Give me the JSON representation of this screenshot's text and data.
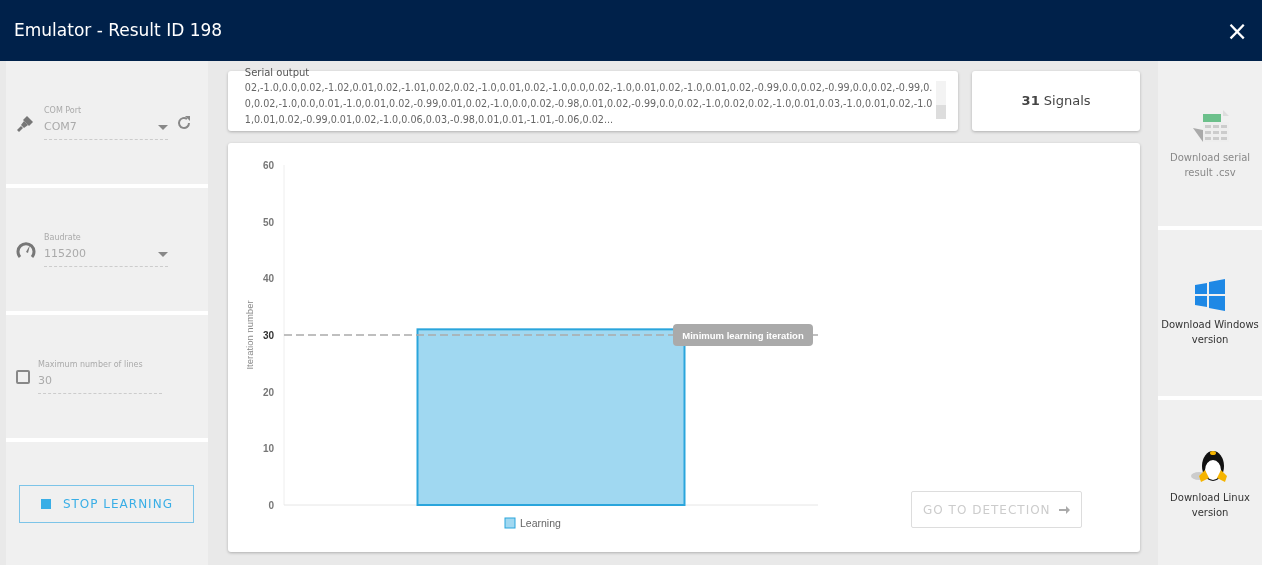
{
  "window": {
    "title": "Emulator - Result ID 198",
    "close": "×"
  },
  "settings": [
    {
      "kind": "select",
      "label": "COM Port",
      "value": "COM7",
      "disabled": true,
      "refresh": true
    },
    {
      "kind": "select",
      "label": "Baudrate",
      "value": "115200",
      "disabled": true,
      "refresh": false
    },
    {
      "kind": "checkbox",
      "label": "Maximum number of lines",
      "value": "30",
      "checked": false,
      "disabled": true
    }
  ],
  "stop_button": {
    "label": "STOP LEARNING"
  },
  "serial_output": {
    "label": "Serial output",
    "text": "02,-1.0,0.0,0.02,-1.02,0.01,0.02,-1.01,0.02,0.02,-1.0,0.01,0.02,-1.0,0.0,0.02,-1.0,0.01,0.02,-1.0,0.01,0.02,-0.99,0.0,0.02,-0.99,0.0,0.02,-0.99,0.0,0.02,-1.0,0.0,0.01,-1.0,0.01,0.02,-0.99,0.01,0.02,-1.0,0.0,0.02,-0.98,0.01,0.02,-0.99,0.0,0.02,-1.0,0.02,0.02,-1.0,0.01,0.03,-1.0,0.01,0.02,-1.01,0.01,0.02,-0.99,0.01,0.02,-1.0,0.06,0.03,-0.98,0.01,0.01,-1.01,-0.06,0.02..."
  },
  "signals": {
    "count": "31",
    "label": "Signals"
  },
  "chart": {
    "chart_data": {
      "type": "bar",
      "ylabel": "Iteration number",
      "ylim": [
        0,
        60
      ],
      "yticks": [
        0,
        10,
        20,
        {
          "value": 30,
          "label": "30"
        },
        40,
        50,
        60
      ],
      "series": [
        {
          "name": "Learning",
          "color": "#a0d8f1",
          "values": [
            31
          ]
        }
      ],
      "annotations": [
        "Minimum learning iteration"
      ]
    }
  },
  "detection_button": {
    "label": "GO TO DETECTION",
    "disabled": true
  },
  "downloads": [
    {
      "kind": "csv",
      "label": "Download serial result .csv",
      "disabled": true
    },
    {
      "kind": "windows",
      "label": "Download Windows version",
      "disabled": false
    },
    {
      "kind": "linux",
      "label": "Download Linux version",
      "disabled": false
    }
  ]
}
